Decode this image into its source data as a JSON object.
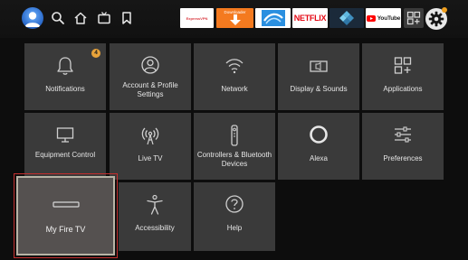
{
  "topbar": {
    "profile_avatar": "avatar",
    "nav_icons": [
      "search-icon",
      "home-icon",
      "tv-icon",
      "bookmark-icon"
    ],
    "apps": [
      {
        "label": "ExpressVPN",
        "bg": "#ffffff",
        "fg": "#da3940"
      },
      {
        "label": "Downloader",
        "bg": "#f47a1f",
        "fg": "#ffffff"
      },
      {
        "label": "",
        "bg": "#ffffff",
        "fg": "#1a8ce0"
      },
      {
        "label": "NETFLIX",
        "bg": "#ffffff",
        "fg": "#e50914"
      },
      {
        "label": "",
        "bg": "#1b2a3a",
        "fg": "#5fb8e0"
      },
      {
        "label": "YouTube",
        "bg": "#ffffff",
        "fg": "#222222"
      }
    ],
    "all_apps_icon": "grid-icon",
    "settings_icon": "gear-icon"
  },
  "settings": {
    "tiles": [
      {
        "label": "Notifications",
        "icon": "bell-icon",
        "badge": "4"
      },
      {
        "label": "Account & Profile Settings",
        "icon": "user-icon"
      },
      {
        "label": "Network",
        "icon": "wifi-icon"
      },
      {
        "label": "Display & Sounds",
        "icon": "display-icon"
      },
      {
        "label": "Applications",
        "icon": "apps-icon"
      },
      {
        "label": "Equipment Control",
        "icon": "tv-icon"
      },
      {
        "label": "Live TV",
        "icon": "antenna-icon"
      },
      {
        "label": "Controllers & Bluetooth Devices",
        "icon": "remote-icon"
      },
      {
        "label": "Alexa",
        "icon": "alexa-icon"
      },
      {
        "label": "Preferences",
        "icon": "sliders-icon"
      },
      {
        "label": "My Fire TV",
        "icon": "firetv-device-icon",
        "focused": true
      },
      {
        "label": "Accessibility",
        "icon": "accessibility-icon"
      },
      {
        "label": "Help",
        "icon": "help-icon"
      }
    ]
  },
  "colors": {
    "background": "#0d0d0d",
    "tile": "#3a3a3a",
    "focus_ring": "#c42e2e",
    "badge": "#e8a33a"
  }
}
